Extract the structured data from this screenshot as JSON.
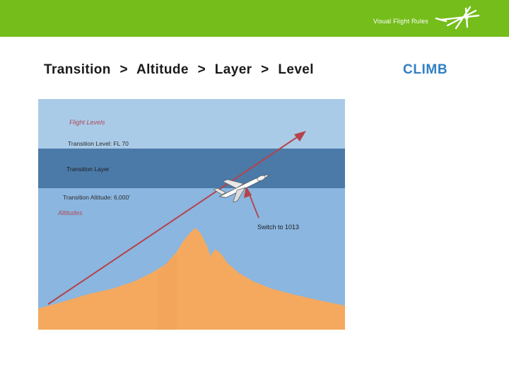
{
  "header": {
    "title": "Visual Flight Rules",
    "logo_icon": "propeller-logo-icon",
    "band_color": "#74bd1b"
  },
  "breadcrumb": {
    "items": [
      "Transition",
      "Altitude",
      "Layer",
      "Level"
    ],
    "separator": ">"
  },
  "phase": {
    "label": "CLIMB",
    "color": "#2f7fc4"
  },
  "figure": {
    "name": "transition-altitude-diagram",
    "labels": {
      "flight_levels": "Flight Levels",
      "transition_level": "Transition Level: FL 70",
      "transition_layer": "Transition Layer",
      "transition_altitude": "Transition Altitude: 6,000'",
      "altitudes": "Altitudes",
      "switch_note": "Switch to 1013"
    },
    "colors": {
      "flight_levels_band": "#aacbe8",
      "transition_layer_band": "#4b7aa8",
      "altitudes_band": "#8ab6e0",
      "terrain": "#f3a košice"
    },
    "aircraft_icon": "airplane-icon",
    "climb_arrow_icon": "climb-arrow-icon",
    "switch_arrow_icon": "switch-arrow-icon"
  }
}
